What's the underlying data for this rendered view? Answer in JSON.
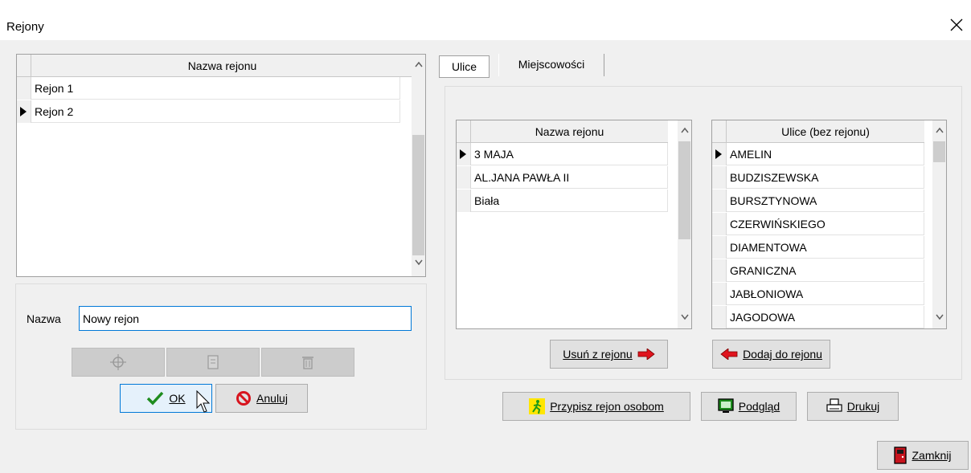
{
  "window": {
    "title": "Rejony",
    "close_glyph": "✕"
  },
  "regions_grid": {
    "header": "Nazwa rejonu",
    "rows": [
      {
        "label": "Rejon 1",
        "current": false
      },
      {
        "label": "Rejon 2",
        "current": true
      }
    ]
  },
  "edit": {
    "name_label": "Nazwa",
    "name_value": "Nowy rejon",
    "ok_label": "OK",
    "cancel_label": "Anuluj"
  },
  "tabs": [
    {
      "label": "Ulice",
      "active": true
    },
    {
      "label": "Miejscowości",
      "active": false
    }
  ],
  "streets_in_region": {
    "header": "Nazwa rejonu",
    "rows": [
      {
        "label": "3 MAJA",
        "current": true
      },
      {
        "label": "AL.JANA PAWŁA II",
        "current": false
      },
      {
        "label": "Biała",
        "current": false
      }
    ]
  },
  "streets_without_region": {
    "header": "Ulice (bez rejonu)",
    "rows": [
      {
        "label": "AMELIN",
        "current": true
      },
      {
        "label": "BUDZISZEWSKA",
        "current": false
      },
      {
        "label": "BURSZTYNOWA",
        "current": false
      },
      {
        "label": "CZERWIŃSKIEGO",
        "current": false
      },
      {
        "label": "DIAMENTOWA",
        "current": false
      },
      {
        "label": "GRANICZNA",
        "current": false
      },
      {
        "label": "JABŁONIOWA",
        "current": false
      },
      {
        "label": "JAGODOWA",
        "current": false
      }
    ]
  },
  "actions": {
    "remove_label": "Usuń z rejonu",
    "add_label": "Dodaj do rejonu",
    "assign_label": "Przypisz rejon osobom",
    "preview_label": "Podgląd",
    "print_label": "Drukuj",
    "close_label": "Zamknij"
  },
  "colors": {
    "accent": "#0078d7",
    "arrow_red": "#e0141e",
    "ok_green": "#1e8c1e",
    "cancel_red": "#d8141e"
  }
}
